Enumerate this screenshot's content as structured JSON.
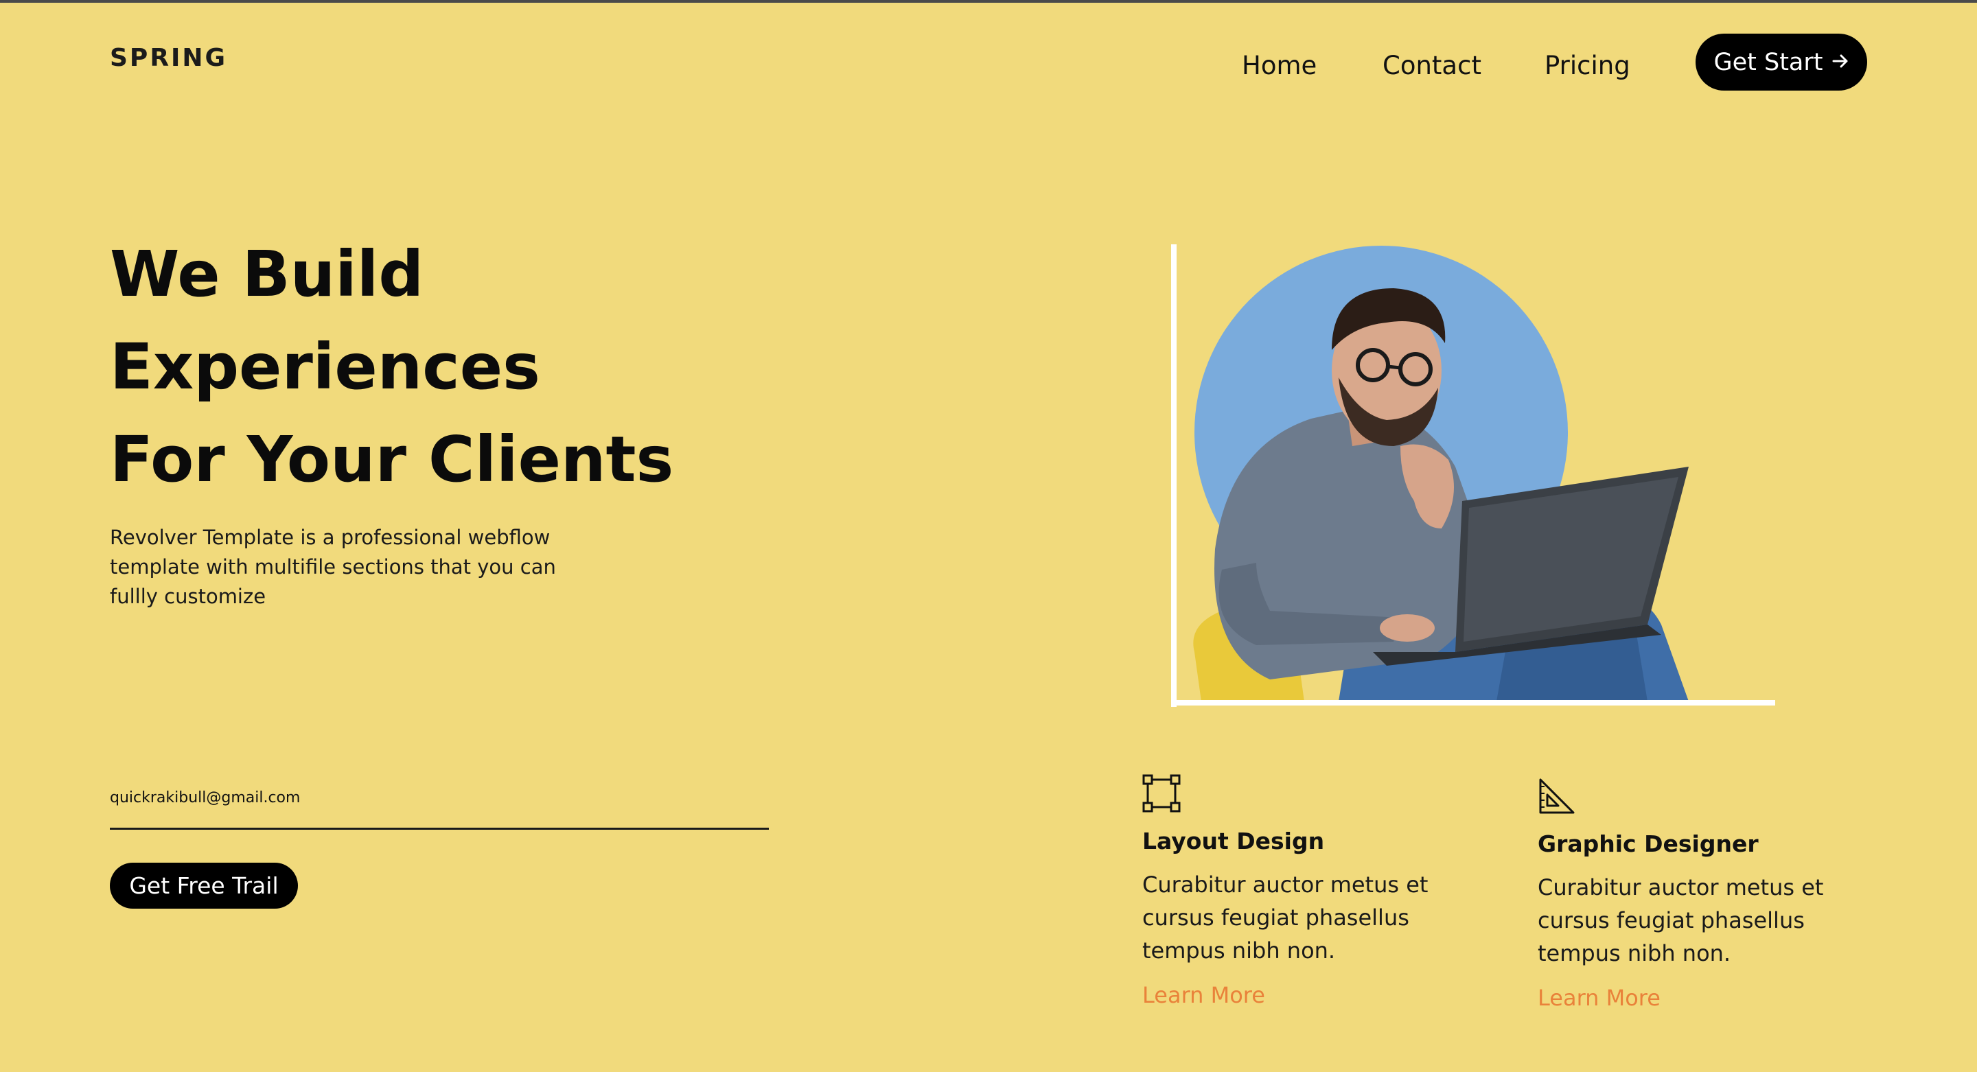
{
  "header": {
    "logo": "SPRING",
    "nav": [
      {
        "label": "Home"
      },
      {
        "label": "Contact"
      },
      {
        "label": "Pricing"
      }
    ],
    "cta_label": "Get Start",
    "cta_icon": "arrow-right-icon"
  },
  "hero": {
    "title_lines": [
      "We Build",
      "Experiences",
      "For Your Clients"
    ],
    "description": "Revolver Template is a professional webflow template with multifile sections that you can fullly customize",
    "email_value": "quickrakibull@gmail.com",
    "button_label": "Get Free Trail"
  },
  "features": [
    {
      "icon": "layout-frame-icon",
      "title": "Layout Design",
      "text": "Curabitur auctor metus et cursus feugiat phasellus tempus nibh non.",
      "link": "Learn More"
    },
    {
      "icon": "set-square-icon",
      "title": "Graphic Designer",
      "text": "Curabitur auctor metus et cursus feugiat phasellus tempus nibh non.",
      "link": "Learn More"
    }
  ],
  "colors": {
    "background": "#f1da7c",
    "button": "#000000",
    "link_accent": "#e9823a",
    "circle": "#7aabdc"
  }
}
